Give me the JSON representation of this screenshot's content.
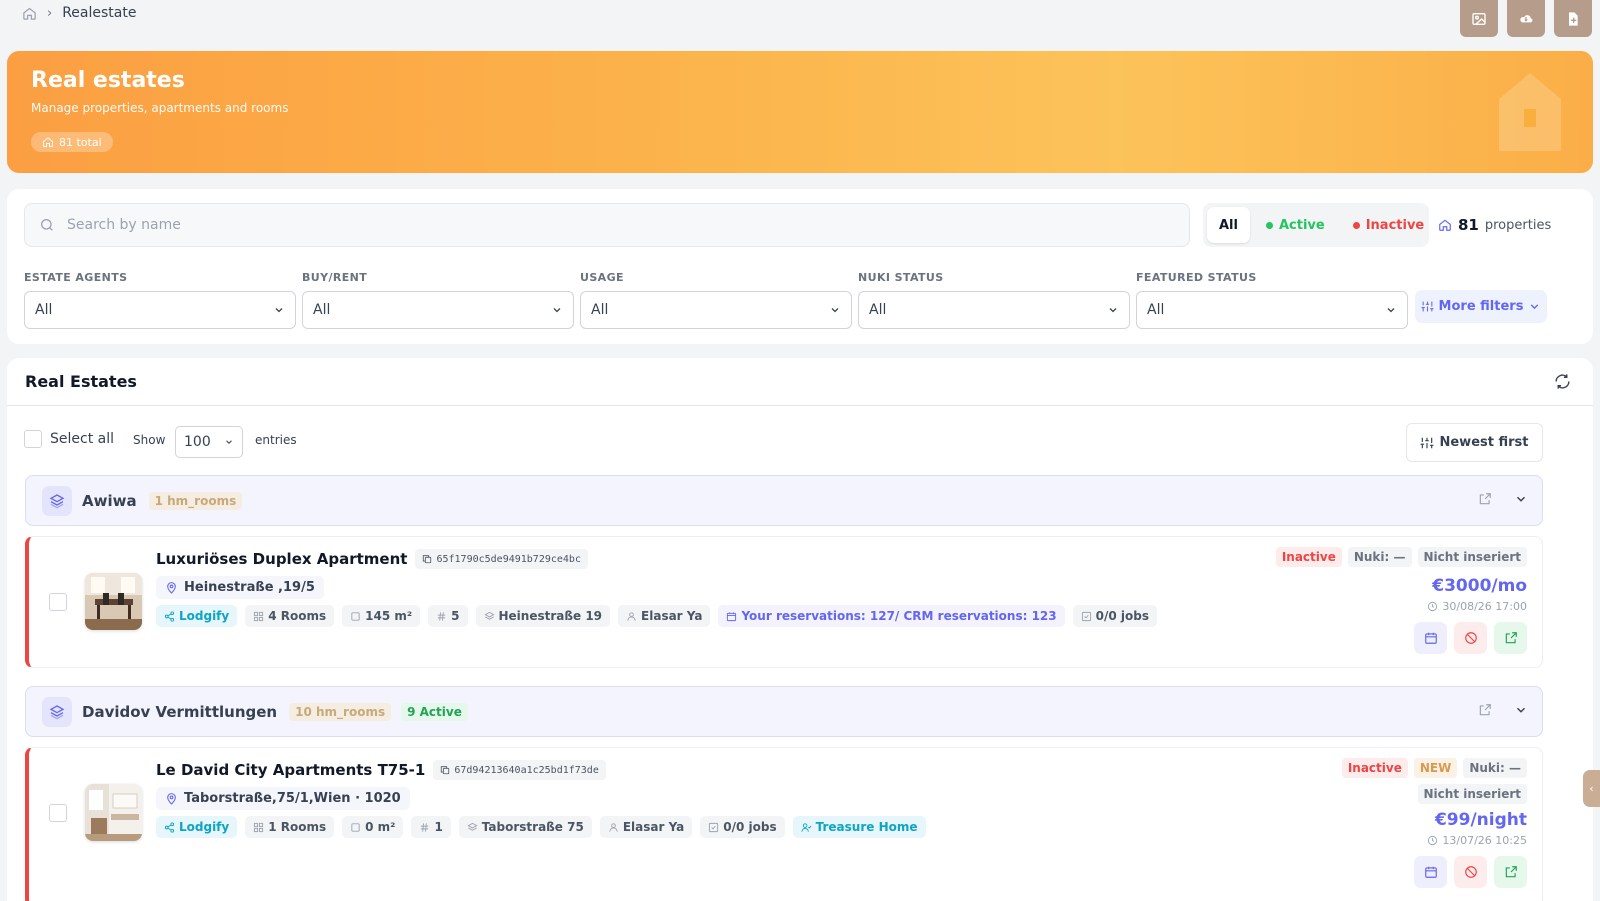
{
  "breadcrumb": {
    "current": "Realestate"
  },
  "top_actions": [
    {
      "icon": "image-icon"
    },
    {
      "icon": "cloud-download-icon"
    },
    {
      "icon": "file-plus-icon"
    }
  ],
  "hero": {
    "title": "Real estates",
    "subtitle": "Manage properties, apartments and rooms",
    "total_label": "81 total"
  },
  "filters": {
    "search_placeholder": "Search by name",
    "search_value": "",
    "status_tabs": {
      "all": "All",
      "active": "Active",
      "inactive": "Inactive"
    },
    "count_number": "81",
    "count_label": "properties",
    "groups": [
      {
        "label": "ESTATE AGENTS",
        "value": "All"
      },
      {
        "label": "BUY/RENT",
        "value": "All"
      },
      {
        "label": "USAGE",
        "value": "All"
      },
      {
        "label": "NUKI STATUS",
        "value": "All"
      },
      {
        "label": "FEATURED STATUS",
        "value": "All"
      }
    ],
    "more_filters": "More filters"
  },
  "list": {
    "title": "Real Estates",
    "select_all": "Select all",
    "show": "Show",
    "entries_value": "100",
    "entries": "entries",
    "sort": "Newest first"
  },
  "groups": [
    {
      "name": "Awiwa",
      "rooms": "1 hm_rooms",
      "estate": {
        "name": "Luxuriöses Duplex Apartment",
        "id": "65f1790c5de9491b729ce4bc",
        "address": "Heinestraße ,19/5",
        "source": "Lodgify",
        "rooms": "4 Rooms",
        "area": "145 m²",
        "number": "5",
        "street": "Heinestraße 19",
        "agent": "Elasar Ya",
        "reservations": "Your reservations: 127/ CRM reservations: 123",
        "jobs": "0/0 jobs",
        "status": "Inactive",
        "nuki": "Nuki: —",
        "listing": "Nicht inseriert",
        "price": "€3000/mo",
        "date": "30/08/26 17:00"
      }
    },
    {
      "name": "Davidov Vermittlungen",
      "rooms": "10 hm_rooms",
      "active": "9 Active",
      "estate": {
        "name": "Le David City Apartments T75-1",
        "id": "67d94213640a1c25bd1f73de",
        "address": "Taborstraße,75/1,Wien · 1020",
        "source": "Lodgify",
        "rooms": "1 Rooms",
        "area": "0 m²",
        "number": "1",
        "street": "Taborstraße 75",
        "agent": "Elasar Ya",
        "jobs": "0/0 jobs",
        "partner": "Treasure Home",
        "status": "Inactive",
        "new": "NEW",
        "nuki": "Nuki: —",
        "listing": "Nicht inseriert",
        "price": "€99/night",
        "date": "13/07/26 10:25"
      }
    }
  ],
  "colors": {
    "brand_orange": "#fb9f42",
    "accent": "#6366f1",
    "active": "#22c55e",
    "inactive": "#ef4444"
  }
}
